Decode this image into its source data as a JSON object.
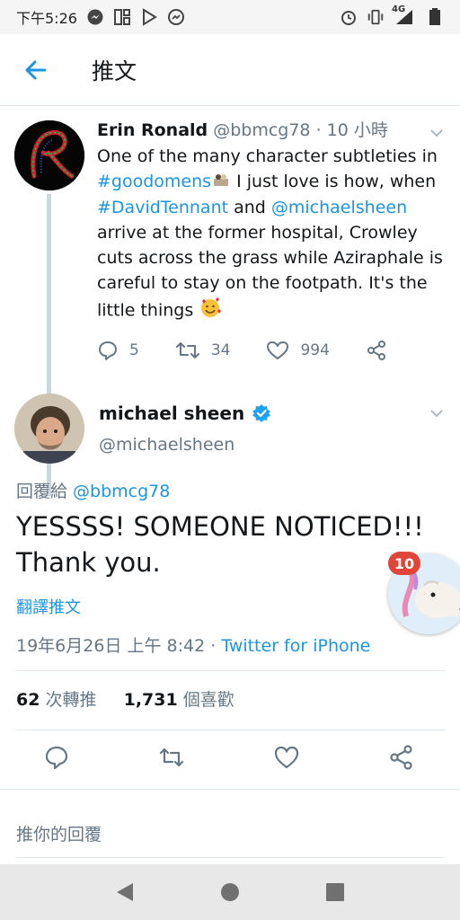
{
  "status_bar": {
    "time": "下午5:26",
    "network": "4G"
  },
  "header": {
    "title": "推文"
  },
  "parent_tweet": {
    "name": "Erin Ronald",
    "handle": "@bbmcg78",
    "separator": " · ",
    "time": "10 小時",
    "text_1": "One of the many character subtleties in ",
    "hashtag_1": "#goodomens",
    "text_2": " I just love is how, when ",
    "hashtag_2": "#DavidTennant",
    "text_3": " and ",
    "mention_1": "@michaelsheen",
    "text_4": " arrive at the former hospital, Crowley cuts across the grass while Aziraphale is careful to stay on the footpath. It's the little things ",
    "replies": "5",
    "retweets": "34",
    "likes": "994"
  },
  "main_tweet": {
    "name": "michael sheen",
    "handle": "@michaelsheen",
    "reply_label": "回覆給 ",
    "reply_handle": "@bbmcg78",
    "text_line_1": "YESSSS! SOMEONE NOTICED!!!",
    "text_line_2": "Thank you.",
    "translate": "翻譯推文",
    "date": "19年6月26日 上午 8:42",
    "date_separator": " · ",
    "source": "Twitter for iPhone",
    "retweet_count": "62",
    "retweet_label": " 次轉推",
    "like_count": "1,731",
    "like_label": " 個喜歡"
  },
  "reply_box": {
    "placeholder": "推你的回覆"
  },
  "chat_head": {
    "badge": "10"
  },
  "colors": {
    "accent": "#1b95e0",
    "verified": "#1da1f2",
    "badge": "#e0453a"
  }
}
